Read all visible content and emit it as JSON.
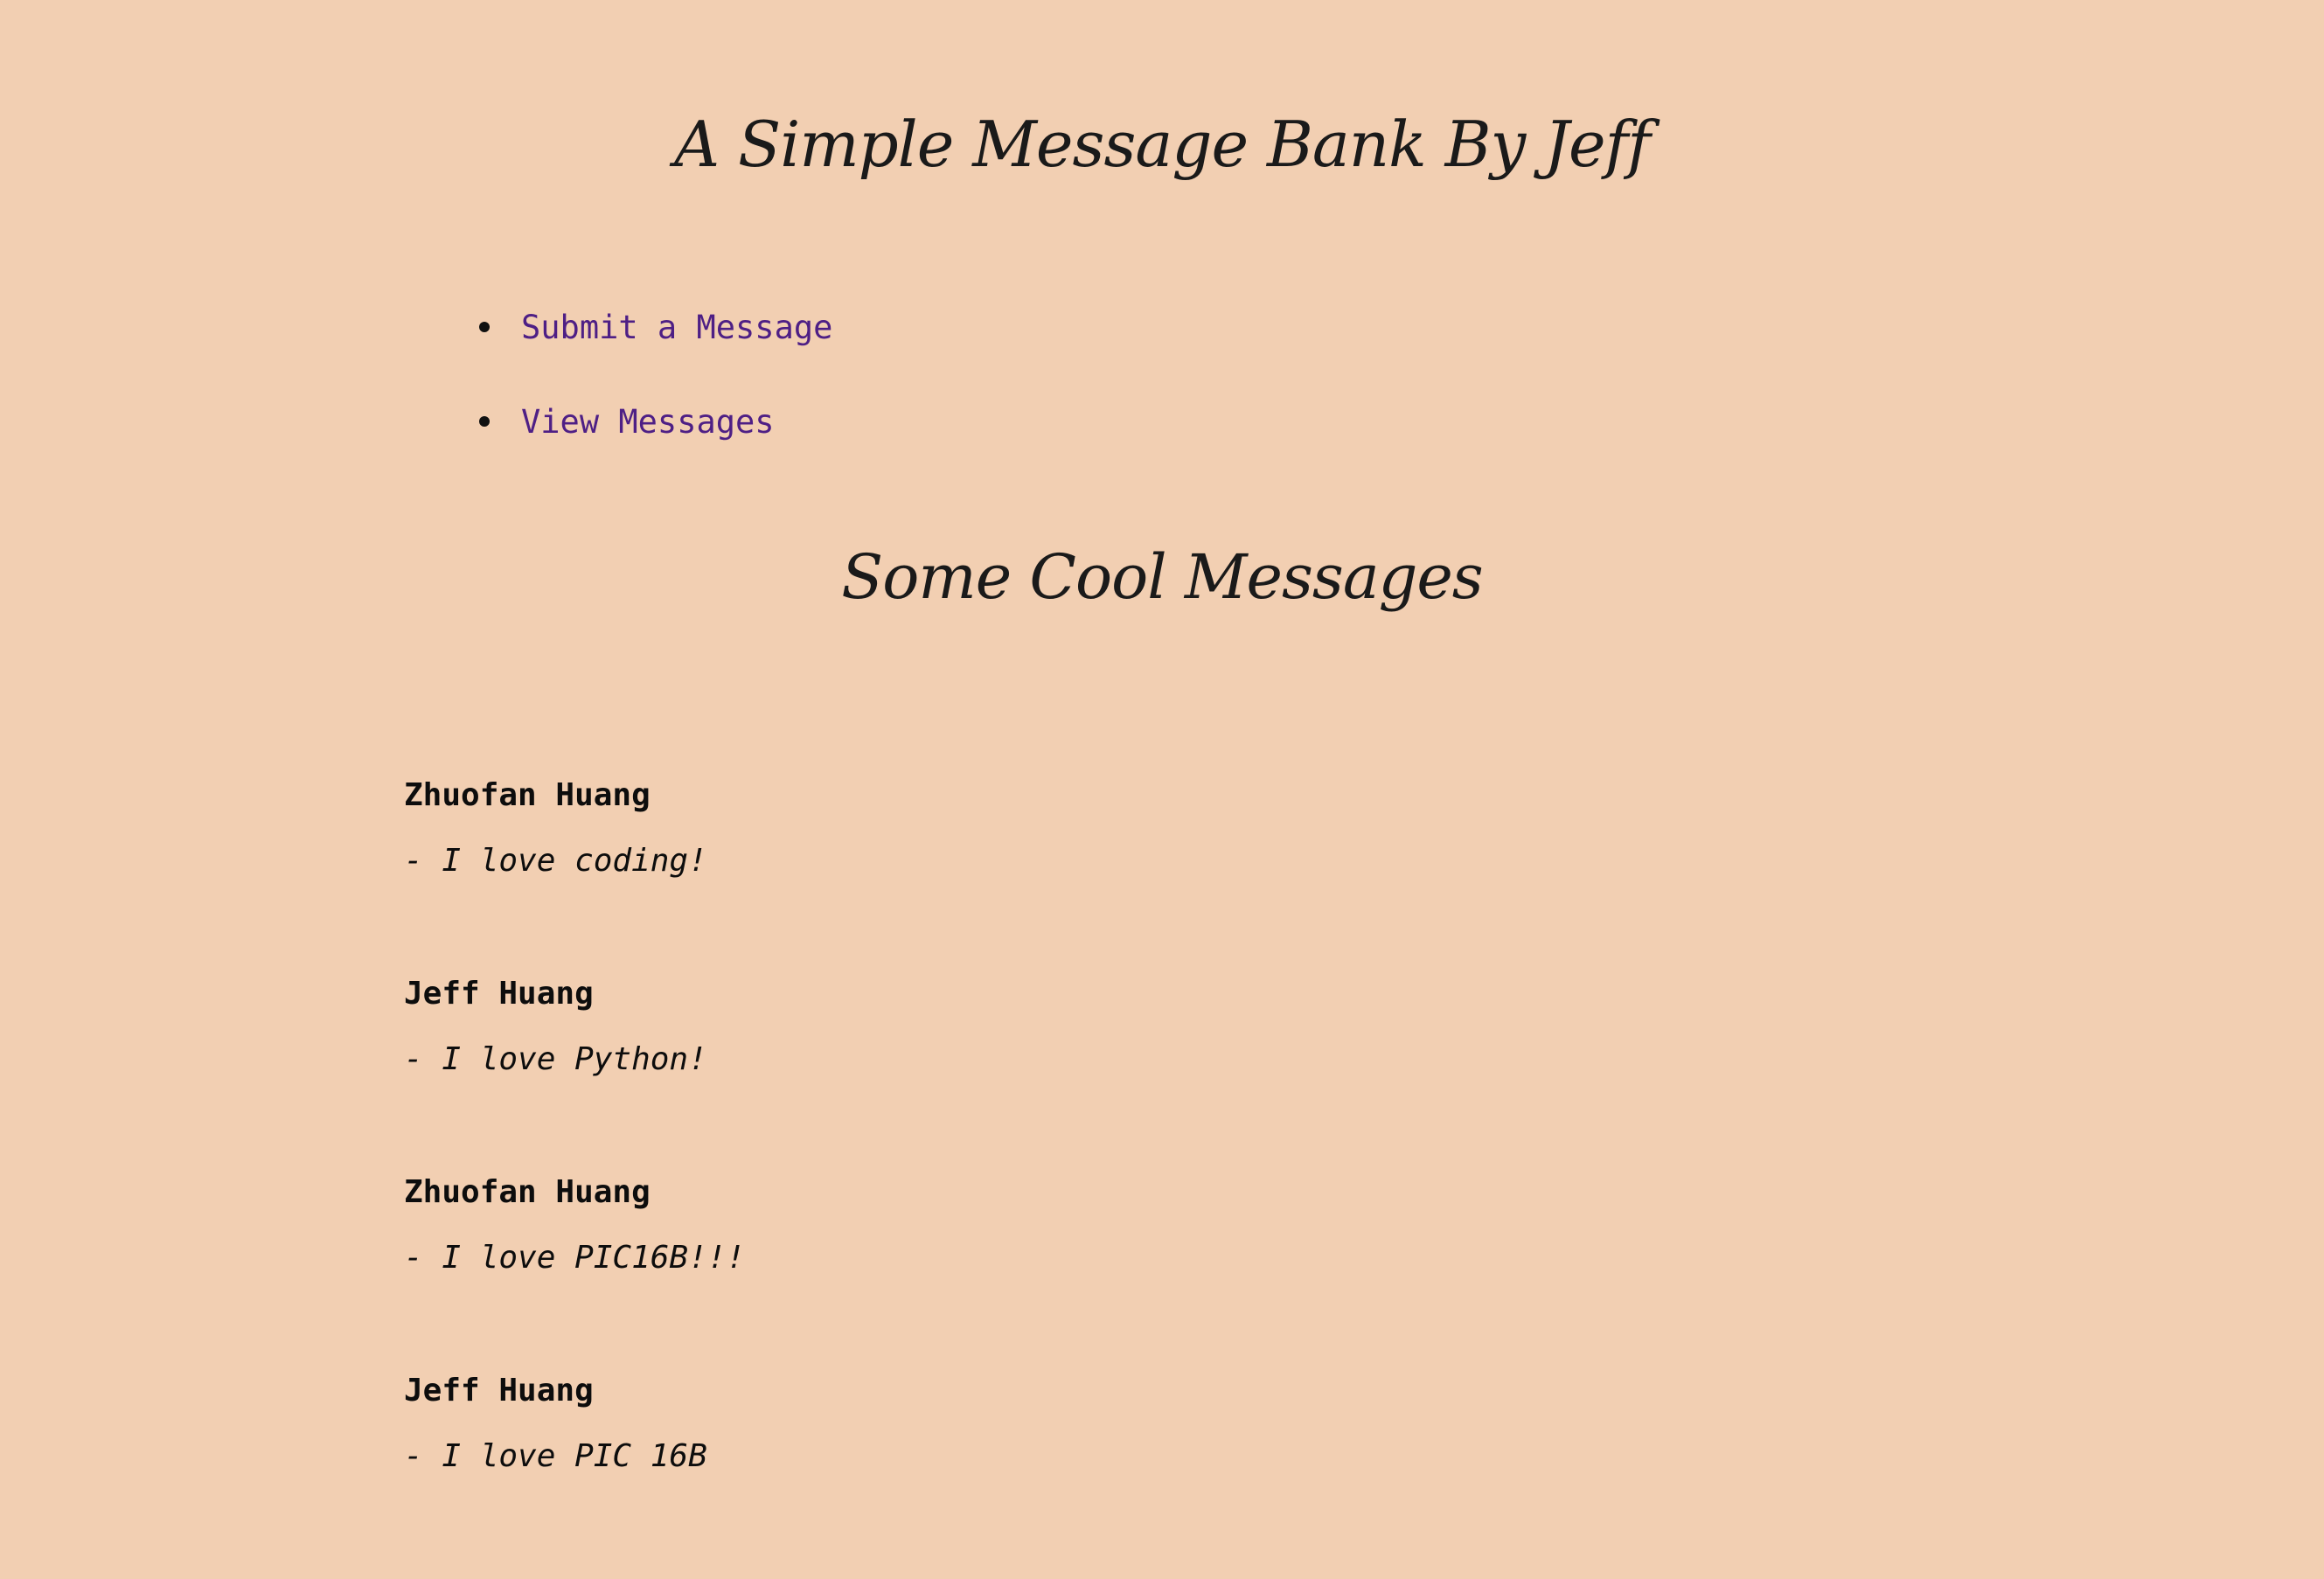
{
  "header": {
    "title": "A Simple Message Bank By Jeff"
  },
  "nav": {
    "items": [
      {
        "label": "Submit a Message"
      },
      {
        "label": "View Messages"
      }
    ]
  },
  "section": {
    "title": "Some Cool Messages"
  },
  "messages": [
    {
      "author": "Zhuofan Huang",
      "text": "- I love coding!"
    },
    {
      "author": "Jeff Huang",
      "text": "- I love Python!"
    },
    {
      "author": "Zhuofan Huang",
      "text": "- I love PIC16B!!!"
    },
    {
      "author": "Jeff Huang",
      "text": "- I love PIC 16B"
    }
  ],
  "colors": {
    "background": "#f2cfb2",
    "link": "#4e1f85",
    "text": "#0d0d0d"
  }
}
